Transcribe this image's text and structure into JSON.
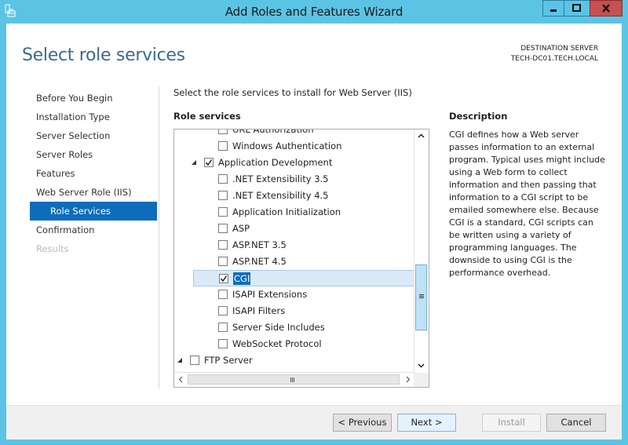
{
  "window": {
    "title": "Add Roles and Features Wizard",
    "controls": {
      "minimize": "minimize",
      "maximize": "maximize",
      "close": "X"
    }
  },
  "header": {
    "page_title": "Select role services",
    "destination_label": "DESTINATION SERVER",
    "destination_server": "TECH-DC01.TECH.LOCAL"
  },
  "nav": {
    "items": [
      {
        "label": "Before You Begin",
        "state": "normal"
      },
      {
        "label": "Installation Type",
        "state": "normal"
      },
      {
        "label": "Server Selection",
        "state": "normal"
      },
      {
        "label": "Server Roles",
        "state": "normal"
      },
      {
        "label": "Features",
        "state": "normal"
      },
      {
        "label": "Web Server Role (IIS)",
        "state": "normal"
      },
      {
        "label": "Role Services",
        "state": "active"
      },
      {
        "label": "Confirmation",
        "state": "normal"
      },
      {
        "label": "Results",
        "state": "disabled"
      }
    ]
  },
  "main": {
    "subtitle": "Select the role services to install for Web Server (IIS)",
    "role_services_label": "Role services",
    "tree": [
      {
        "label": "URL Authorization",
        "checked": false,
        "level": 2,
        "partial": true
      },
      {
        "label": "Windows Authentication",
        "checked": false,
        "level": 2
      },
      {
        "label": "Application Development",
        "checked": true,
        "level": 1,
        "expanded": true
      },
      {
        "label": ".NET Extensibility 3.5",
        "checked": false,
        "level": 2
      },
      {
        "label": ".NET Extensibility 4.5",
        "checked": false,
        "level": 2
      },
      {
        "label": "Application Initialization",
        "checked": false,
        "level": 2
      },
      {
        "label": "ASP",
        "checked": false,
        "level": 2
      },
      {
        "label": "ASP.NET 3.5",
        "checked": false,
        "level": 2
      },
      {
        "label": "ASP.NET 4.5",
        "checked": false,
        "level": 2
      },
      {
        "label": "CGI",
        "checked": true,
        "level": 2,
        "selected": true
      },
      {
        "label": "ISAPI Extensions",
        "checked": false,
        "level": 2
      },
      {
        "label": "ISAPI Filters",
        "checked": false,
        "level": 2
      },
      {
        "label": "Server Side Includes",
        "checked": false,
        "level": 2
      },
      {
        "label": "WebSocket Protocol",
        "checked": false,
        "level": 2
      },
      {
        "label": "FTP Server",
        "checked": false,
        "level": 0,
        "expanded": true
      }
    ]
  },
  "description": {
    "heading": "Description",
    "text": "CGI defines how a Web server passes information to an external program. Typical uses might include using a Web form to collect information and then passing that information to a CGI script to be emailed somewhere else. Because CGI is a standard, CGI scripts can be written using a variety of programming languages. The downside to using CGI is the performance overhead."
  },
  "footer": {
    "previous": "< Previous",
    "next": "Next >",
    "install": "Install",
    "cancel": "Cancel"
  }
}
